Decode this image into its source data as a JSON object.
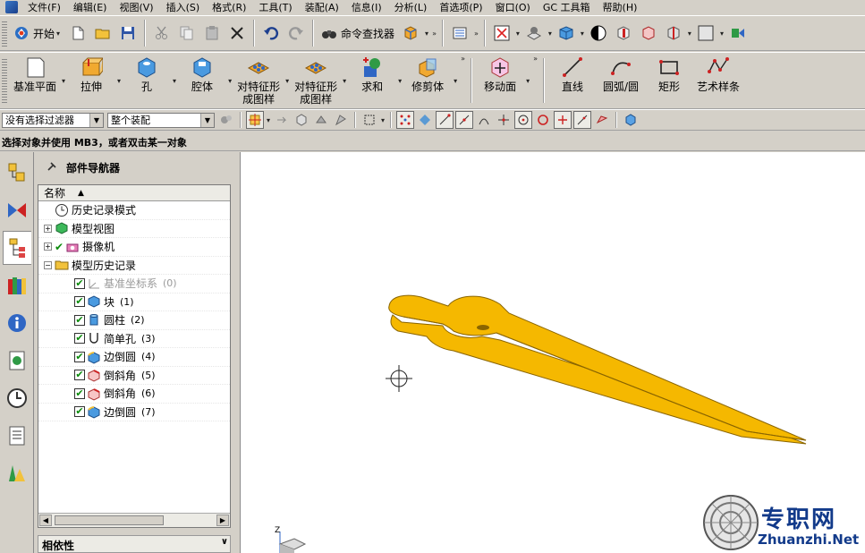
{
  "menu": [
    "文件(F)",
    "编辑(E)",
    "视图(V)",
    "插入(S)",
    "格式(R)",
    "工具(T)",
    "装配(A)",
    "信息(I)",
    "分析(L)",
    "首选项(P)",
    "窗口(O)",
    "GC 工具箱",
    "帮助(H)"
  ],
  "toolbar1": {
    "start_label": "开始",
    "finder_label": "命令查找器"
  },
  "feature_tools": [
    {
      "label": "基准平面",
      "icon": "datum-plane-icon"
    },
    {
      "label": "拉伸",
      "icon": "extrude-icon"
    },
    {
      "label": "孔",
      "icon": "hole-icon"
    },
    {
      "label": "腔体",
      "icon": "pocket-icon"
    },
    {
      "label": "对特征形\n成图样",
      "icon": "pattern-feature-icon"
    },
    {
      "label": "对特征形\n成图样",
      "icon": "pattern-feature-icon"
    },
    {
      "label": "求和",
      "icon": "unite-icon"
    },
    {
      "label": "修剪体",
      "icon": "trim-body-icon"
    }
  ],
  "sync_tools": [
    {
      "label": "移动面",
      "icon": "move-face-icon"
    }
  ],
  "sketch_tools": [
    {
      "label": "直线",
      "icon": "line-icon"
    },
    {
      "label": "圆弧/圆",
      "icon": "arc-icon"
    },
    {
      "label": "矩形",
      "icon": "rectangle-icon"
    },
    {
      "label": "艺术样条",
      "icon": "spline-icon"
    }
  ],
  "selection": {
    "filter_value": "没有选择过滤器",
    "scope_value": "整个装配"
  },
  "cue_line": "选择对象并使用 MB3，或者双击某一对象",
  "navigator": {
    "title": "部件导航器",
    "column_name": "名称",
    "nodes": [
      {
        "label": "历史记录模式",
        "icon": "clock-icon",
        "level": 0,
        "expander": "",
        "checked": false,
        "id": ""
      },
      {
        "label": "模型视图",
        "icon": "model-views-icon",
        "level": 0,
        "expander": "+",
        "checked": false,
        "id": ""
      },
      {
        "label": "摄像机",
        "icon": "camera-icon",
        "level": 0,
        "expander": "+",
        "checked": true,
        "id": ""
      },
      {
        "label": "模型历史记录",
        "icon": "folder-icon",
        "level": 0,
        "expander": "−",
        "checked": false,
        "id": ""
      },
      {
        "label": "基准坐标系",
        "icon": "datum-csys-icon",
        "level": 1,
        "expander": "",
        "checked": true,
        "id": "(0)",
        "dim": true
      },
      {
        "label": "块",
        "icon": "block-icon",
        "level": 1,
        "expander": "",
        "checked": true,
        "id": "(1)"
      },
      {
        "label": "圆柱",
        "icon": "cylinder-icon",
        "level": 1,
        "expander": "",
        "checked": true,
        "id": "(2)"
      },
      {
        "label": "简单孔",
        "icon": "simple-hole-icon",
        "level": 1,
        "expander": "",
        "checked": true,
        "id": "(3)"
      },
      {
        "label": "边倒圆",
        "icon": "edge-blend-icon",
        "level": 1,
        "expander": "",
        "checked": true,
        "id": "(4)"
      },
      {
        "label": "倒斜角",
        "icon": "chamfer-icon",
        "level": 1,
        "expander": "",
        "checked": true,
        "id": "(5)"
      },
      {
        "label": "倒斜角",
        "icon": "chamfer-icon",
        "level": 1,
        "expander": "",
        "checked": true,
        "id": "(6)"
      },
      {
        "label": "边倒圆",
        "icon": "edge-blend-icon",
        "level": 1,
        "expander": "",
        "checked": true,
        "id": "(7)"
      }
    ],
    "dependency_label": "相依性"
  },
  "viewport": {
    "part_color": "#f5b800",
    "part_edge_color": "#8a6500",
    "triad_z_label": "Z"
  },
  "watermark": {
    "text": "专职网",
    "url": "Zhuanzhi.Net"
  }
}
